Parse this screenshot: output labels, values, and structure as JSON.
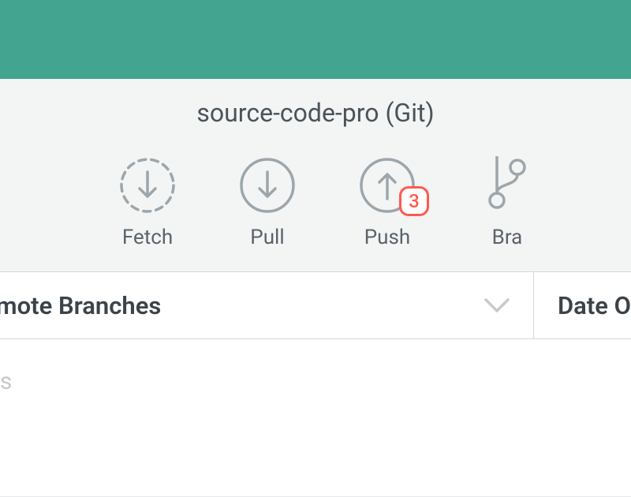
{
  "repo": {
    "title": "source-code-pro (Git)"
  },
  "toolbar": {
    "fetch": {
      "label": "Fetch"
    },
    "pull": {
      "label": "Pull"
    },
    "push": {
      "label": "Push",
      "badge": "3"
    },
    "branch": {
      "label": "Bra"
    }
  },
  "filters": {
    "remote_branches_label": "emote Branches",
    "date_column_label": "Date O"
  },
  "list": {
    "row_partial": "aces"
  }
}
